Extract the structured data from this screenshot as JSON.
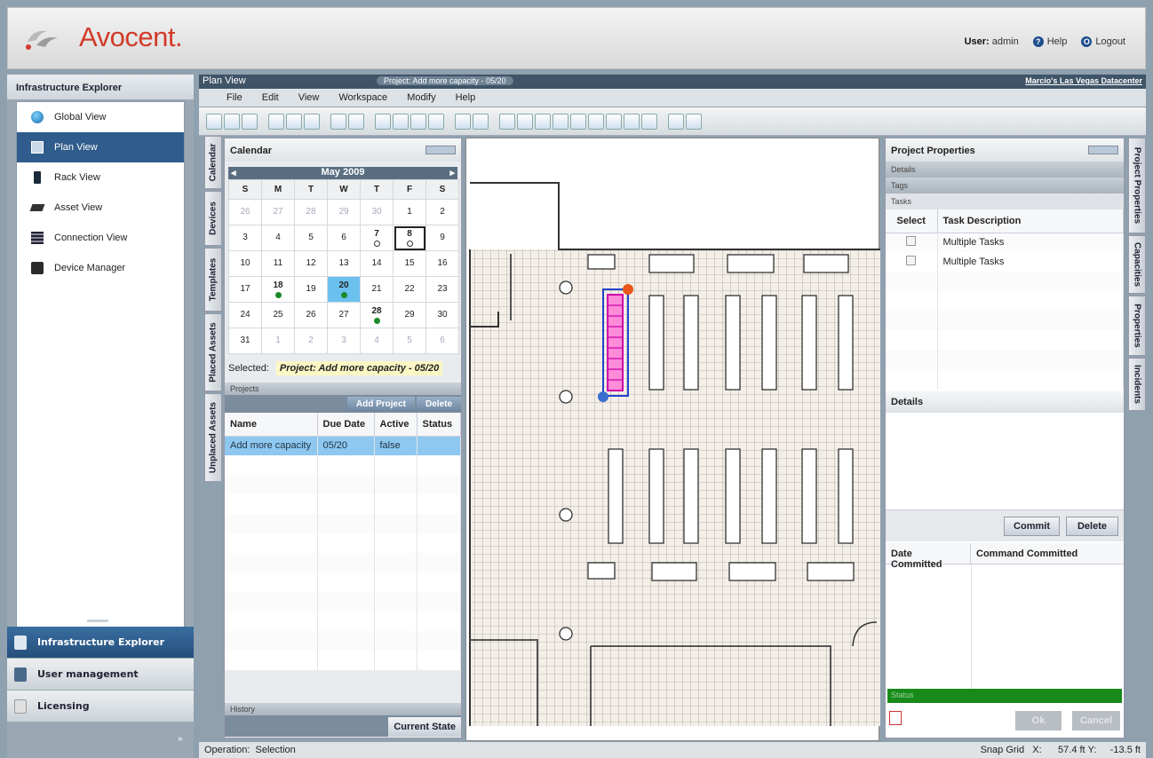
{
  "header": {
    "logo": "Avocent.",
    "user_label": "User:",
    "user_name": "admin",
    "help": "Help",
    "logout": "Logout"
  },
  "left": {
    "title": "Infrastructure Explorer",
    "items": [
      {
        "label": "Global View",
        "icon": "globe-icon"
      },
      {
        "label": "Plan View",
        "icon": "plan-icon",
        "selected": true
      },
      {
        "label": "Rack View",
        "icon": "rack-icon"
      },
      {
        "label": "Asset View",
        "icon": "asset-icon"
      },
      {
        "label": "Connection View",
        "icon": "connection-icon"
      },
      {
        "label": "Device Manager",
        "icon": "device-manager-icon"
      }
    ],
    "bottom": [
      {
        "label": "Infrastructure Explorer",
        "selected": true
      },
      {
        "label": "User management"
      },
      {
        "label": "Licensing"
      }
    ],
    "collapse": "»"
  },
  "main": {
    "title": "Plan View",
    "project": "Project: Add more capacity - 05/20",
    "datacenter": "Marcio's Las Vegas Datacenter",
    "menu": [
      "File",
      "Edit",
      "View",
      "Workspace",
      "Modify",
      "Help"
    ]
  },
  "vtabs": [
    "Calendar",
    "Devices",
    "Templates",
    "Placed Assets",
    "Unplaced Assets"
  ],
  "calendar": {
    "title": "Calendar",
    "month": "May 2009",
    "days": [
      "S",
      "M",
      "T",
      "W",
      "T",
      "F",
      "S"
    ],
    "weeks": [
      [
        "26",
        "27",
        "28",
        "29",
        "30",
        "1",
        "2"
      ],
      [
        "3",
        "4",
        "5",
        "6",
        "7",
        "8",
        "9"
      ],
      [
        "10",
        "11",
        "12",
        "13",
        "14",
        "15",
        "16"
      ],
      [
        "17",
        "18",
        "19",
        "20",
        "21",
        "22",
        "23"
      ],
      [
        "24",
        "25",
        "26",
        "27",
        "28",
        "29",
        "30"
      ],
      [
        "31",
        "1",
        "2",
        "3",
        "4",
        "5",
        "6"
      ]
    ],
    "selected_label": "Selected:",
    "selected_value": "Project: Add more capacity - 05/20"
  },
  "projects": {
    "label": "Projects",
    "add_button": "Add Project",
    "delete_button": "Delete",
    "columns": [
      "Name",
      "Due Date",
      "Active",
      "Status"
    ],
    "rows": [
      [
        "Add more capacity",
        "05/20",
        "false",
        ""
      ]
    ],
    "history": "History",
    "current_state": "Current State"
  },
  "props": {
    "title": "Project Properties",
    "sections": [
      "Details",
      "Tags",
      "Tasks"
    ],
    "task_columns": [
      "Select",
      "Task Description"
    ],
    "tasks": [
      "Multiple Tasks",
      "Multiple Tasks"
    ],
    "details_title": "Details",
    "commit_button": "Commit",
    "delete_button": "Delete",
    "commit_columns": [
      "Date Committed",
      "Command Committed"
    ],
    "status": "Status",
    "ok": "Ok",
    "cancel": "Cancel"
  },
  "rtabs": [
    "Project Properties",
    "Capacities",
    "Properties",
    "Incidents"
  ],
  "status": {
    "operation_label": "Operation:",
    "operation": "Selection",
    "snap": "Snap Grid",
    "x_label": "X:",
    "x": "57.4 ft",
    "y_label": "Y:",
    "y": "-13.5 ft"
  }
}
